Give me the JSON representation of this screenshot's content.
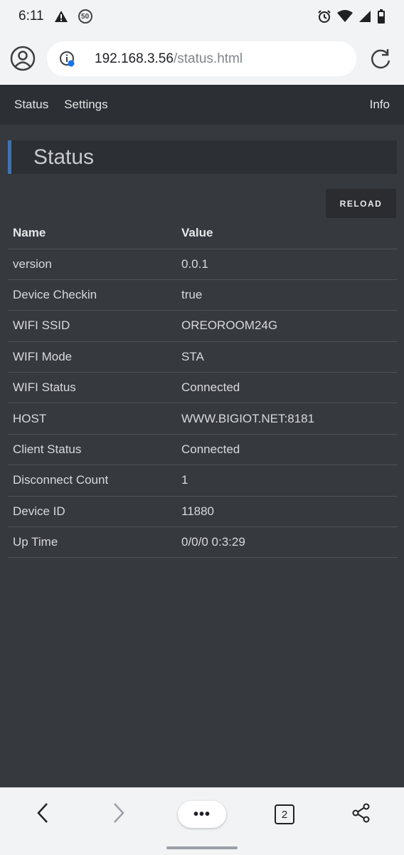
{
  "status_bar": {
    "time": "6:11",
    "badge": "50",
    "icons": [
      "warning-icon",
      "alarm-icon",
      "wifi-icon",
      "signal-icon",
      "battery-icon"
    ]
  },
  "browser": {
    "url_host": "192.168.3.56",
    "url_path": "/status.html",
    "tab_count": "2",
    "more_label": "•••"
  },
  "nav": {
    "status": "Status",
    "settings": "Settings",
    "info": "Info"
  },
  "panel": {
    "title": "Status",
    "reload": "RELOAD"
  },
  "table": {
    "headers": [
      "Name",
      "Value"
    ],
    "rows": [
      [
        "version",
        "0.0.1"
      ],
      [
        "Device Checkin",
        "true"
      ],
      [
        "WIFI SSID",
        "OREOROOM24G"
      ],
      [
        "WIFI Mode",
        "STA"
      ],
      [
        "WIFI Status",
        "Connected"
      ],
      [
        "HOST",
        "WWW.BIGIOT.NET:8181"
      ],
      [
        "Client Status",
        "Connected"
      ],
      [
        "Disconnect Count",
        "1"
      ],
      [
        "Device ID",
        "11880"
      ],
      [
        "Up Time",
        "0/0/0 0:3:29"
      ]
    ]
  },
  "colors": {
    "accent": "#3d73b9",
    "page_bg": "#36393e",
    "nav_bg": "#2c2f33"
  }
}
